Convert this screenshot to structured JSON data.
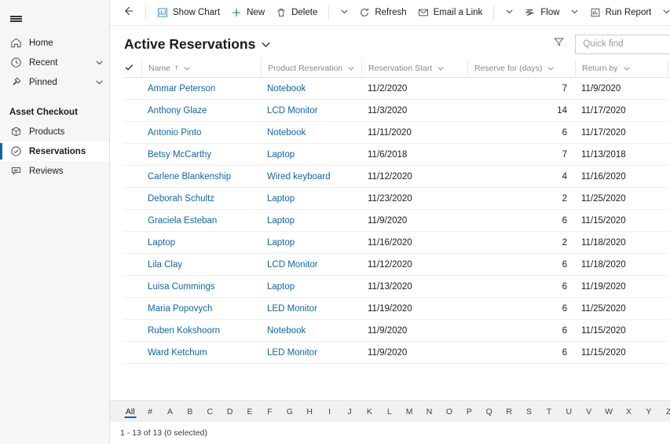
{
  "sidebar": {
    "hamburger_label": "site-map-toggle",
    "nav": [
      {
        "label": "Home",
        "icon": "home-icon",
        "chevron": false
      },
      {
        "label": "Recent",
        "icon": "clock-icon",
        "chevron": true
      },
      {
        "label": "Pinned",
        "icon": "pin-icon",
        "chevron": true
      }
    ],
    "group_title": "Asset Checkout",
    "group_items": [
      {
        "label": "Products",
        "icon": "box-icon",
        "selected": false
      },
      {
        "label": "Reservations",
        "icon": "check-circle-icon",
        "selected": true
      },
      {
        "label": "Reviews",
        "icon": "comment-icon",
        "selected": false
      }
    ]
  },
  "commandbar": {
    "back_label": "back-arrow",
    "buttons": [
      {
        "label": "Show Chart",
        "icon": "chart-icon"
      },
      {
        "label": "New",
        "icon": "plus-icon"
      },
      {
        "label": "Delete",
        "icon": "trash-icon"
      }
    ],
    "more_chevron_1": "chevron-down",
    "buttons2": [
      {
        "label": "Refresh",
        "icon": "refresh-icon"
      },
      {
        "label": "Email a Link",
        "icon": "email-icon"
      }
    ],
    "more_chevron_2": "chevron-down",
    "buttons3": [
      {
        "label": "Flow",
        "icon": "flow-icon",
        "chevron": true
      },
      {
        "label": "Run Report",
        "icon": "report-icon",
        "chevron": true
      }
    ],
    "overflow_label": "more-commands"
  },
  "view": {
    "title": "Active Reservations",
    "title_chevron": "chevron-down",
    "filter_label": "edit-filters"
  },
  "search": {
    "placeholder": "Quick find",
    "value": "",
    "icon": "search-icon"
  },
  "grid": {
    "columns": [
      {
        "label": "Name",
        "sort": "↑",
        "chevron": true,
        "class": "c-name",
        "align": "left"
      },
      {
        "label": "Product Reservation",
        "sort": "",
        "chevron": true,
        "class": "c-prod",
        "align": "left"
      },
      {
        "label": "Reservation Start",
        "sort": "",
        "chevron": true,
        "class": "c-start",
        "align": "left"
      },
      {
        "label": "Reserve for (days)",
        "sort": "",
        "chevron": true,
        "class": "c-days",
        "align": "left"
      },
      {
        "label": "Return by",
        "sort": "",
        "chevron": true,
        "class": "c-ret",
        "align": "left"
      }
    ],
    "rows": [
      {
        "name": "Ammar Peterson",
        "product": "Notebook",
        "start": "11/2/2020",
        "days": "7",
        "return": "11/9/2020"
      },
      {
        "name": "Anthony Glaze",
        "product": "LCD Monitor",
        "start": "11/3/2020",
        "days": "14",
        "return": "11/17/2020"
      },
      {
        "name": "Antonio Pinto",
        "product": "Notebook",
        "start": "11/11/2020",
        "days": "6",
        "return": "11/17/2020"
      },
      {
        "name": "Betsy McCarthy",
        "product": "Laptop",
        "start": "11/6/2018",
        "days": "7",
        "return": "11/13/2018"
      },
      {
        "name": "Carlene Blankenship",
        "product": "Wired keyboard",
        "start": "11/12/2020",
        "days": "4",
        "return": "11/16/2020"
      },
      {
        "name": "Deborah Schultz",
        "product": "Laptop",
        "start": "11/23/2020",
        "days": "2",
        "return": "11/25/2020"
      },
      {
        "name": "Graciela Esteban",
        "product": "Laptop",
        "start": "11/9/2020",
        "days": "6",
        "return": "11/15/2020"
      },
      {
        "name": "Laptop",
        "product": "Laptop",
        "start": "11/16/2020",
        "days": "2",
        "return": "11/18/2020"
      },
      {
        "name": "Lila Clay",
        "product": "LCD Monitor",
        "start": "11/12/2020",
        "days": "6",
        "return": "11/18/2020"
      },
      {
        "name": "Luisa Cummings",
        "product": "Laptop",
        "start": "11/13/2020",
        "days": "6",
        "return": "11/19/2020"
      },
      {
        "name": "Maria Popovych",
        "product": "LED Monitor",
        "start": "11/19/2020",
        "days": "6",
        "return": "11/25/2020"
      },
      {
        "name": "Ruben Kokshoorn",
        "product": "Notebook",
        "start": "11/9/2020",
        "days": "6",
        "return": "11/15/2020"
      },
      {
        "name": "Ward Ketchum",
        "product": "LED Monitor",
        "start": "11/9/2020",
        "days": "6",
        "return": "11/15/2020"
      }
    ]
  },
  "alphabet_filter": {
    "active": "All",
    "items": [
      "All",
      "#",
      "A",
      "B",
      "C",
      "D",
      "E",
      "F",
      "G",
      "H",
      "I",
      "J",
      "K",
      "L",
      "M",
      "N",
      "O",
      "P",
      "Q",
      "R",
      "S",
      "T",
      "U",
      "V",
      "W",
      "X",
      "Y",
      "Z"
    ]
  },
  "status": {
    "record_count": "1 - 13 of 13 (0 selected)"
  },
  "colors": {
    "link": "#1264a3",
    "accent": "#1264a3",
    "sidebar_bg": "#f6f6f6",
    "alpha_bar_bg": "#f0f0f0",
    "new_icon_green": "#107c41",
    "chart_icon_blue": "#2b7cd3"
  }
}
